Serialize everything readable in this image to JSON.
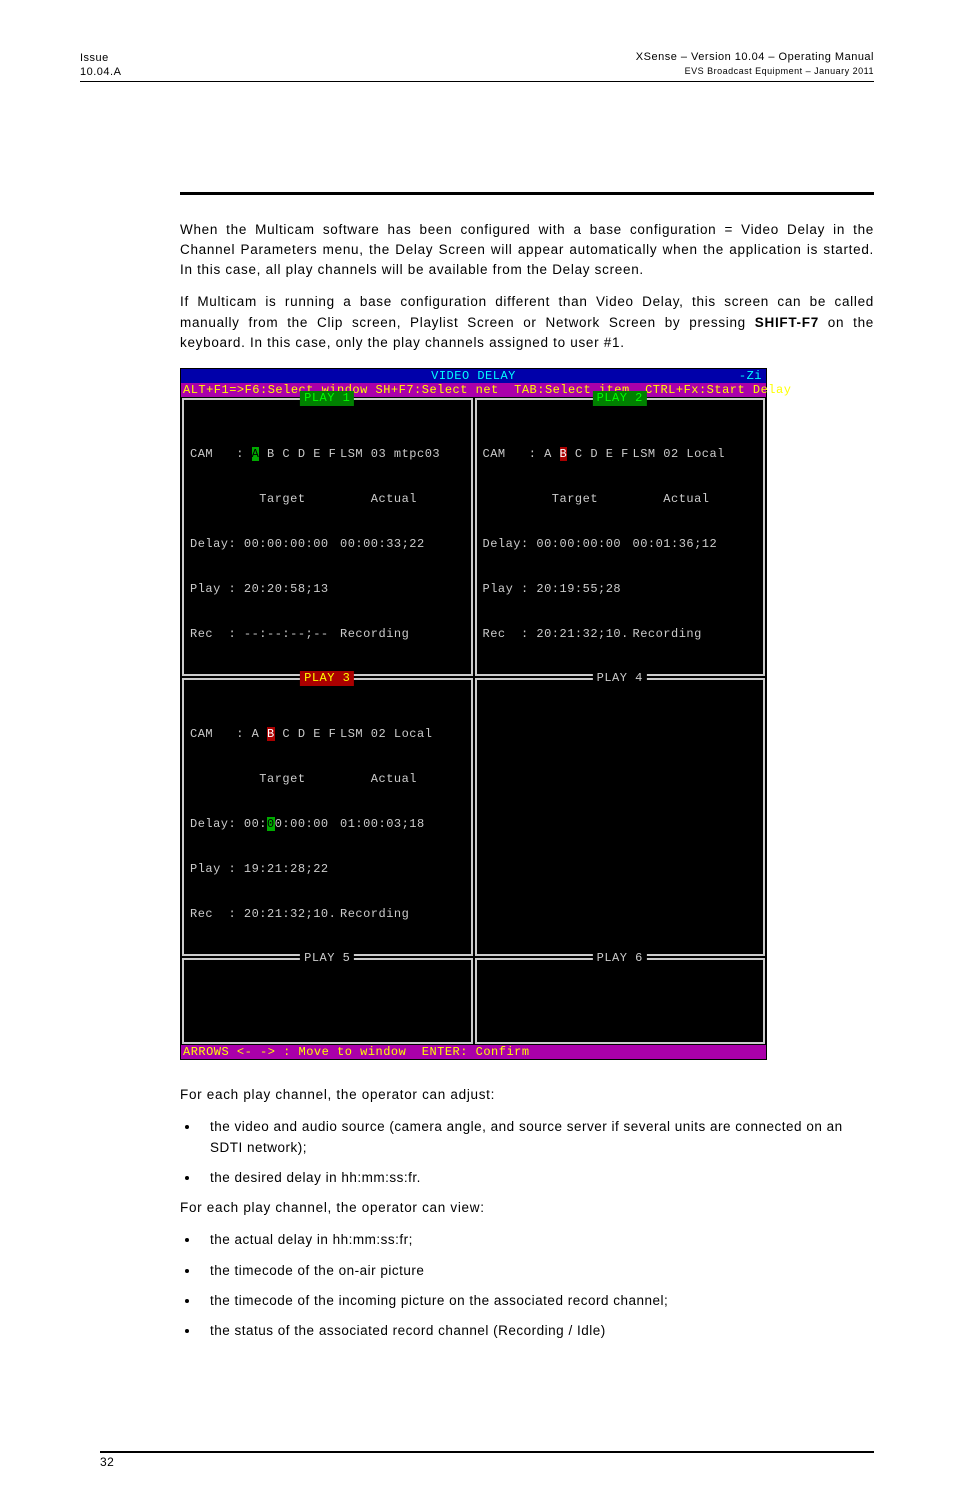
{
  "header": {
    "left_line1": "Issue",
    "left_line2": "10.04.A",
    "right_line1": "XSense – Version 10.04 – Operating Manual",
    "right_line2": "EVS Broadcast Equipment  – January 2011"
  },
  "para1": "When the Multicam software has been configured with a base configuration = Video Delay in the Channel Parameters menu, the Delay Screen will appear automatically when the application is started. In this case, all play channels will be available from the Delay screen.",
  "para2a": "If Multicam is running a base configuration different than Video Delay, this screen can be called manually from the Clip screen, Playlist Screen or Network Screen by pressing ",
  "para2b": "SHIFT-F7",
  "para2c": " on the keyboard. In this case, only the play channels assigned to user #1.",
  "terminal": {
    "title": "VIDEO DELAY",
    "tag": "-Zi",
    "keys": "ALT+F1=>F6:Select window SH+F7:Select net  TAB:Select item  CTRL+Fx:Start Delay",
    "footer": "ARROWS <- -> : Move to window  ENTER: Confirm",
    "panels": [
      {
        "title": "PLAY 1",
        "title_style": "green",
        "cam_prefix": "CAM   : ",
        "cam_hl": "A",
        "cam_rest": " B C D E F",
        "src": "LSM 03 mtpc03",
        "target_label": "         Target",
        "target_val": "    Actual",
        "delay": "Delay: 00:00:00:00",
        "delay_val": "00:00:33;22",
        "play": "Play : 20:20:58;13",
        "rec": "Rec  : --:--:--;--",
        "rec_val": "Recording"
      },
      {
        "title": "PLAY 2",
        "title_style": "green",
        "cam_prefix": "CAM   : A ",
        "cam_hl": "B",
        "cam_rest": " C D E F",
        "src": "LSM 02 Local",
        "target_label": "         Target",
        "target_val": "    Actual",
        "delay": "Delay: 00:00:00:00",
        "delay_val": "00:01:36;12",
        "play": "Play : 20:19:55;28",
        "rec": "Rec  : 20:21:32;10.",
        "rec_val": "Recording"
      },
      {
        "title": "PLAY 3",
        "title_style": "yellow",
        "cam_prefix": "CAM   : A ",
        "cam_hl": "B",
        "cam_rest": " C D E F",
        "src": "LSM 02 Local",
        "target_label": "         Target",
        "target_val": "    Actual",
        "delay_pre": "Delay: 00:",
        "delay_hl": "0",
        "delay_post": "0:00:00",
        "delay_val": "01:00:03;18",
        "play": "Play : 19:21:28;22",
        "rec": "Rec  : 20:21:32;10.",
        "rec_val": "Recording"
      },
      {
        "title": "PLAY 4",
        "title_style": "plain"
      },
      {
        "title": "PLAY 5",
        "title_style": "plain"
      },
      {
        "title": "PLAY 6",
        "title_style": "plain"
      }
    ]
  },
  "adjust_intro": "For each play channel, the operator can adjust:",
  "adjust_items": [
    "the video and audio source (camera angle, and source server if several units are connected on an SDTI network);",
    "the desired delay in hh:mm:ss:fr."
  ],
  "view_intro": "For each play channel, the operator can view:",
  "view_items": [
    "the actual delay in hh:mm:ss:fr;",
    "the timecode of the on-air picture",
    "the timecode of the incoming picture on the associated record channel;",
    "the status of the associated record channel (Recording / Idle)"
  ],
  "page_number": "32"
}
